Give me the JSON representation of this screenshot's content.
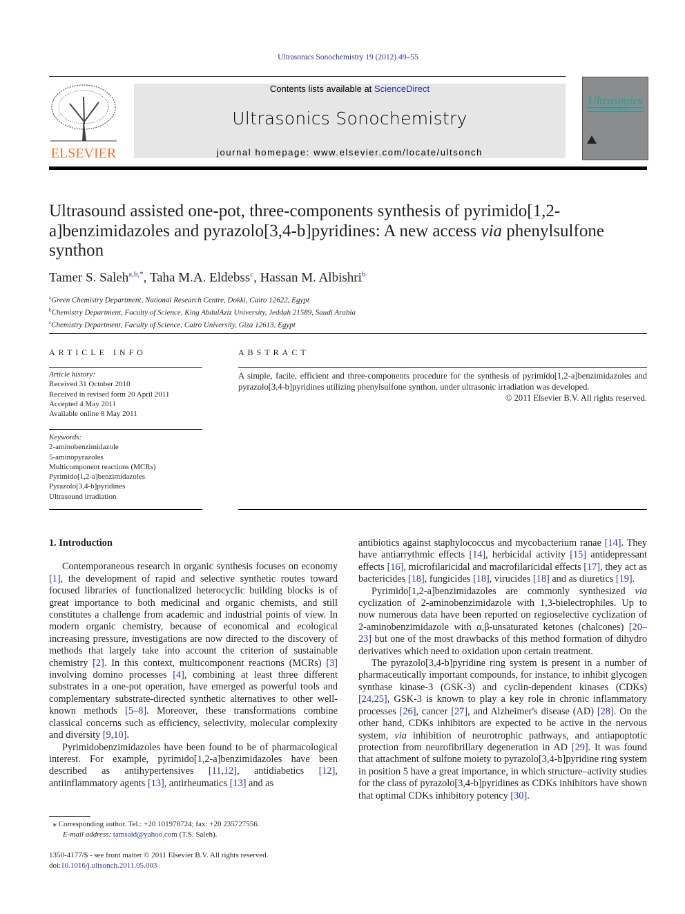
{
  "header": {
    "citation": "Ultrasonics Sonochemistry 19 (2012) 49–55",
    "contents_prefix": "Contents lists available at ",
    "contents_link": "ScienceDirect",
    "journal_title": "Ultrasonics Sonochemistry",
    "homepage": "journal homepage: www.elsevier.com/locate/ultsonch",
    "publisher_logo": "ELSEVIER",
    "cover_title": "Ultrasonics",
    "cover_subtitle": "SONOCHEMISTRY",
    "colors": {
      "publisher": "#f37021",
      "link": "#2e3192",
      "banner": "#e6e6e6",
      "cover_accent": "#1aa39a"
    }
  },
  "article": {
    "title_part1": "Ultrasound assisted one-pot, three-components synthesis of pyrimido[1,2-a]benzimidazoles and pyrazolo[3,4-b]pyridines: A new access ",
    "title_italic": "via",
    "title_part2": " phenylsulfone synthon",
    "authors": [
      {
        "name": "Tamer S. Saleh",
        "sup": "a,b,*"
      },
      {
        "name": "Taha M.A. Eldebss",
        "sup": "c"
      },
      {
        "name": "Hassan M. Albishri",
        "sup": "b"
      }
    ],
    "affiliations": [
      {
        "mark": "a",
        "text": "Green Chemistry Department, National Research Centre, Dokki, Cairo 12622, Egypt"
      },
      {
        "mark": "b",
        "text": "Chemistry Department, Faculty of Science, King AbdulAziz University, Jeddah 21589, Saudi Arabia"
      },
      {
        "mark": "c",
        "text": "Chemistry Department, Faculty of Science, Cairo University, Giza 12613, Egypt"
      }
    ]
  },
  "info": {
    "heading": "ARTICLE INFO",
    "history_label": "Article history:",
    "history": [
      "Received 31 October 2010",
      "Received in revised form 20 April 2011",
      "Accepted 4 May 2011",
      "Available online 8 May 2011"
    ],
    "keywords_label": "Keywords:",
    "keywords": [
      "2-aminobenzimidazole",
      "5-aminopyrazoles",
      "Multicomponent reactions (MCRs)",
      "Pyrimido[1,2-a]benzimidazoles",
      "Pyrazolo[3,4-b]pyridines",
      "Ultrasound irradiation"
    ]
  },
  "abstract": {
    "heading": "ABSTRACT",
    "text": "A simple, facile, efficient and three-components procedure for the synthesis of pyrimido[1,2-a]benzimidazoles and pyrazolo[3,4-b]pyridines utilizing phenylsulfone synthon, under ultrasonic irradiation was developed.",
    "copyright": "© 2011 Elsevier B.V. All rights reserved."
  },
  "body": {
    "intro_heading": "1. Introduction",
    "left_paragraphs": [
      [
        [
          "Contemporaneous research in organic synthesis focuses on economy "
        ],
        [
          "[1]",
          1
        ],
        [
          ", the development of rapid and selective synthetic routes toward focused libraries of functionalized heterocyclic building blocks is of great importance to both medicinal and organic chemists, and still constitutes a challenge from academic and industrial points of view. In modern organic chemistry, because of economical and ecological increasing pressure, investigations are now directed to the discovery of methods that largely take into account the criterion of sustainable chemistry "
        ],
        [
          "[2]",
          1
        ],
        [
          ". In this context, multicomponent reactions (MCRs) "
        ],
        [
          "[3]",
          1
        ],
        [
          " involving domino processes "
        ],
        [
          "[4]",
          1
        ],
        [
          ", combining at least three different substrates in a one-pot operation, have emerged as powerful tools and complementary substrate-directed synthetic alternatives to other well-known methods "
        ],
        [
          "[5–8]",
          1
        ],
        [
          ". Moreover, these transformations combine classical concerns such as efficiency, selectivity, molecular complexity and diversity "
        ],
        [
          "[9,10]",
          1
        ],
        [
          "."
        ]
      ],
      [
        [
          "Pyrimidobenzimidazoles have been found to be of pharmacological interest. For example, pyrimido[1,2-a]benzimidazoles have been described as antihypertensives "
        ],
        [
          "[11,12]",
          1
        ],
        [
          ", antidiabetics "
        ],
        [
          "[12]",
          1
        ],
        [
          ", antiinflammatory agents "
        ],
        [
          "[13]",
          1
        ],
        [
          ", antirheumatics "
        ],
        [
          "[13]",
          1
        ],
        [
          " and as"
        ]
      ]
    ],
    "right_paragraphs": [
      [
        [
          "antibiotics against staphylococcus and mycobacterium ranae "
        ],
        [
          "[14]",
          1
        ],
        [
          ". They have antiarrythmic effects "
        ],
        [
          "[14]",
          1
        ],
        [
          ", herbicidal activity "
        ],
        [
          "[15]",
          1
        ],
        [
          " antidepressant effects "
        ],
        [
          "[16]",
          1
        ],
        [
          ", microfilaricidal and macrofilaricidal effects "
        ],
        [
          "[17]",
          1
        ],
        [
          ", they act as bactericides "
        ],
        [
          "[18]",
          1
        ],
        [
          ", fungicides "
        ],
        [
          "[18]",
          1
        ],
        [
          ", virucides "
        ],
        [
          "[18]",
          1
        ],
        [
          " and as diuretics "
        ],
        [
          "[19]",
          1
        ],
        [
          "."
        ]
      ],
      [
        [
          "Pyrimido[1,2-a]benzimidazoles are commonly synthesized "
        ],
        [
          "via",
          2
        ],
        [
          " cyclization of 2-aminobenzimidazole with 1,3-bielectrophiles. Up to now numerous data have been reported on regioselective cyclization of 2-aminobenzimidazole with α,β-unsaturated ketones (chalcones) "
        ],
        [
          "[20–23]",
          1
        ],
        [
          " but one of the most drawbacks of this method formation of dihydro derivatives which need to oxidation upon certain treatment."
        ]
      ],
      [
        [
          "The pyrazolo[3,4-b]pyridine ring system is present in a number of pharmaceutically important compounds, for instance, to inhibit glycogen synthase kinase-3 (GSK-3) and cyclin-dependent kinases (CDKs) "
        ],
        [
          "[24,25]",
          1
        ],
        [
          ", GSK-3 is known to play a key role in chronic inflammatory processes "
        ],
        [
          "[26]",
          1
        ],
        [
          ", cancer "
        ],
        [
          "[27]",
          1
        ],
        [
          ", and Alzheimer's disease (AD) "
        ],
        [
          "[28]",
          1
        ],
        [
          ". On the other hand, CDKs inhibitors are expected to be active in the nervous system, "
        ],
        [
          "via",
          2
        ],
        [
          " inhibition of neurotrophic pathways, and antiapoptotic protection from neurofibrillary degeneration in AD "
        ],
        [
          "[29]",
          1
        ],
        [
          ". It was found that attachment of sulfone moiety to pyrazolo[3,4-b]pyridine ring system in position 5 have a great importance, in which structure–activity studies for the class of pyrazolo[3,4-b]pyridines as CDKs inhibitors have shown that optimal CDKs inhibitory potency "
        ],
        [
          "[30]",
          1
        ],
        [
          "."
        ]
      ]
    ]
  },
  "footer": {
    "corresponding": "Corresponding author. Tel.: +20 101978724; fax: +20 235727556.",
    "email_label": "E-mail address:",
    "email": "tamsaid@yahoo.com",
    "email_suffix": " (T.S. Saleh).",
    "issn": "1350-4177/$ - see front matter © 2011 Elsevier B.V. All rights reserved.",
    "doi_label": "doi:",
    "doi": "10.1016/j.ultsonch.2011.05.003"
  }
}
